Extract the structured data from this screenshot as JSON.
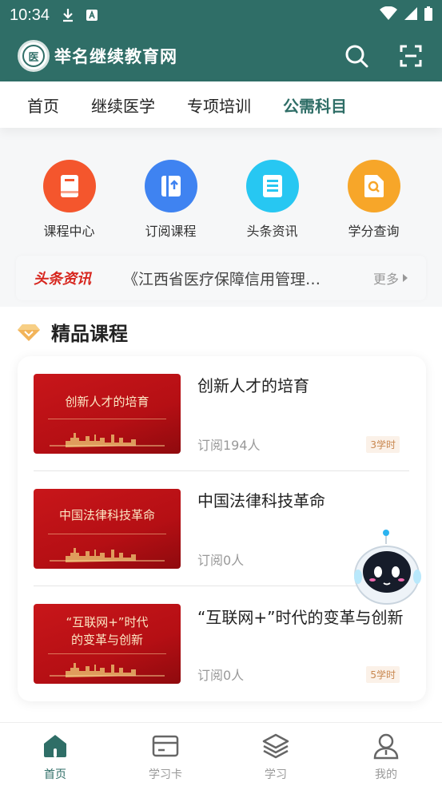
{
  "status": {
    "time": "10:34"
  },
  "header": {
    "brand": "举名继续教育网",
    "logo_char": "医"
  },
  "tabs": [
    {
      "label": "首页"
    },
    {
      "label": "继续医学"
    },
    {
      "label": "专项培训"
    },
    {
      "label": "公需科目",
      "active": true
    }
  ],
  "quick_links": [
    {
      "label": "课程中心",
      "icon": "book-icon",
      "color": "#f4562d"
    },
    {
      "label": "订阅课程",
      "icon": "subscribe-icon",
      "color": "#3f83f1"
    },
    {
      "label": "头条资讯",
      "icon": "news-icon",
      "color": "#27c7f2"
    },
    {
      "label": "学分查询",
      "icon": "credit-search-icon",
      "color": "#f7a629"
    }
  ],
  "news": {
    "tag": "头条资讯",
    "text": "《江西省医疗保障信用管理…",
    "more": "更多"
  },
  "section": {
    "title": "精品课程"
  },
  "courses": [
    {
      "thumb_title": "创新人才的培育",
      "title": "创新人才的培育",
      "sub": "订阅194人",
      "badge": "3学时"
    },
    {
      "thumb_title": "中国法律科技革命",
      "title": "中国法律科技革命",
      "sub": "订阅0人",
      "badge": ""
    },
    {
      "thumb_title_1": "“互联网+”时代",
      "thumb_title_2": "的变革与创新",
      "title": "“互联网+”时代的变革与创新",
      "sub": "订阅0人",
      "badge": "5学时"
    }
  ],
  "bottom_nav": [
    {
      "label": "首页",
      "icon": "home-icon",
      "active": true
    },
    {
      "label": "学习卡",
      "icon": "card-icon"
    },
    {
      "label": "学习",
      "icon": "layers-icon"
    },
    {
      "label": "我的",
      "icon": "user-icon"
    }
  ],
  "colors": {
    "primary": "#2f6e67",
    "news_red": "#d7261e",
    "badge": "#c9874f"
  }
}
